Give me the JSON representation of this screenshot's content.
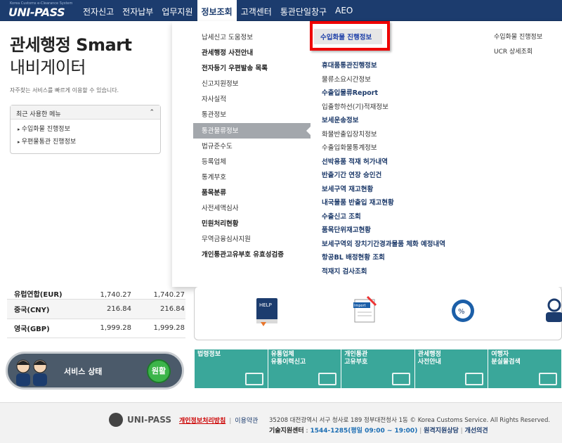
{
  "header": {
    "logo_tagline": "Korea Customs e-Clearance System",
    "logo_text": "UNI-PASS",
    "nav": [
      "전자신고",
      "전자납부",
      "업무지원",
      "정보조회",
      "고객센터",
      "통관단일창구",
      "AEO"
    ],
    "active_nav": "정보조회"
  },
  "hero": {
    "title": "관세행정 Smart",
    "subtitle": "내비게이터",
    "desc": "자주찾는 서비스를 빠르게 이용할 수 있습니다."
  },
  "recent": {
    "header": "최근 사용한 메뉴",
    "items": [
      "수입화물 진행정보",
      "우편물통관 진행정보"
    ]
  },
  "menu": {
    "col1": [
      {
        "label": "납세신고 도움정보",
        "bold": false
      },
      {
        "label": "관세행정 사전안내",
        "bold": true
      },
      {
        "label": "전자등기 우편발송 목록",
        "bold": true
      },
      {
        "label": "신고지원정보",
        "bold": false
      },
      {
        "label": "자사실적",
        "bold": false
      },
      {
        "label": "통관정보",
        "bold": false
      },
      {
        "label": "통관물류정보",
        "bold": false,
        "selected": true
      },
      {
        "label": "법규준수도",
        "bold": false
      },
      {
        "label": "등록업체",
        "bold": false
      },
      {
        "label": "통계부호",
        "bold": false
      },
      {
        "label": "품목분류",
        "bold": true
      },
      {
        "label": "사전세액심사",
        "bold": false
      },
      {
        "label": "민원처리현황",
        "bold": true
      },
      {
        "label": "무역금융심사지원",
        "bold": false
      },
      {
        "label": "개인통관고유부호 유효성검증",
        "bold": true
      }
    ],
    "highlighted": "수입화물 진행정보",
    "col2": [
      {
        "label": "휴대품통관진행정보",
        "bold": true
      },
      {
        "label": "물류소요시간정보",
        "bold": false
      },
      {
        "label": "수출입물류Report",
        "bold": true
      },
      {
        "label": "입출항하선(기)적재정보",
        "bold": false
      },
      {
        "label": "보세운송정보",
        "bold": true
      },
      {
        "label": "화물반출입장치정보",
        "bold": false
      },
      {
        "label": "수출입화물통계정보",
        "bold": false
      },
      {
        "label": "선박용품 적재 허가내역",
        "bold": true
      },
      {
        "label": "반출기간 연장 승인건",
        "bold": true
      },
      {
        "label": "보세구역 재고현황",
        "bold": true
      },
      {
        "label": "내국물품 반출입 재고현황",
        "bold": true
      },
      {
        "label": "수출신고 조회",
        "bold": true
      },
      {
        "label": "품목단위재고현황",
        "bold": true
      },
      {
        "label": "보세구역외 장치기간경과물품 체화 예정내역",
        "bold": true
      },
      {
        "label": "항공BL 배정현황 조회",
        "bold": true
      },
      {
        "label": "적재지 검사조회",
        "bold": true
      }
    ],
    "col3": [
      "수입화물 진행정보",
      "UCR 상세조회"
    ]
  },
  "rates": [
    {
      "country": "유럽연합(EUR)",
      "v1": "1,740.27",
      "v2": "1,740.27"
    },
    {
      "country": "중국(CNY)",
      "v1": "216.84",
      "v2": "216.84"
    },
    {
      "country": "영국(GBP)",
      "v1": "1,999.28",
      "v2": "1,999.28"
    }
  ],
  "icons": [
    "help-book-icon",
    "import-document-icon",
    "tariff-globe-icon",
    "agent-icon"
  ],
  "service": {
    "label": "서비스 상태",
    "status": "원활",
    "status_color": "#3cb54a"
  },
  "tiles": [
    {
      "line1": "법령정보",
      "line2": ""
    },
    {
      "line1": "유통업체",
      "line2": "유통이력신고"
    },
    {
      "line1": "개인통관",
      "line2": "고유부호"
    },
    {
      "line1": "관세행정",
      "line2": "사전안내"
    },
    {
      "line1": "여행자",
      "line2": "분실물검색"
    }
  ],
  "footer": {
    "brand": "UNI-PASS",
    "privacy": "개인정보처리방침",
    "terms": "이용약관",
    "address": "35208 대전광역시 서구 청사로 189 정부대전청사 1동 © Korea Customs Service. All Rights Reserved.",
    "support_label": "기술지원센터",
    "support_phone": "1544-1285(평일 09:00 ~ 19:00)",
    "remote": "원격지원상담",
    "feedback": "개선의견"
  },
  "colors": {
    "nav_bg": "#1c3c6e",
    "tile": "#3aa79a",
    "highlight": "#e00000"
  }
}
